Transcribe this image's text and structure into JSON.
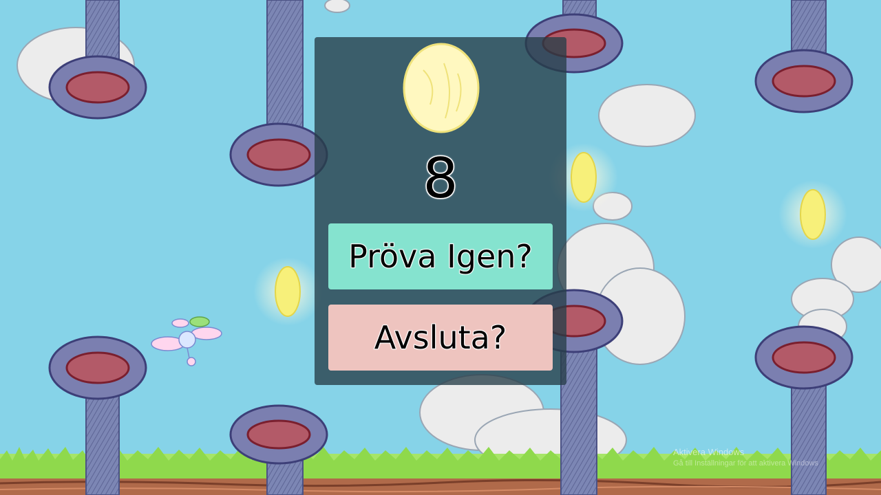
{
  "game": {
    "score": "8",
    "retry_label": "Pröva Igen?",
    "quit_label": "Avsluta?"
  },
  "watermark": {
    "title": "Aktivera Windows",
    "subtitle": "Gå till Inställningar för att aktivera Windows"
  },
  "colors": {
    "sky": "#86d3e8",
    "overlay": "#263e48",
    "retry_button": "#85e3cf",
    "quit_button": "#eec4bf",
    "grass": "#9ee25a",
    "dirt": "#b06a4a",
    "pillar": "#6f78a6",
    "coin": "#f7f07a"
  }
}
